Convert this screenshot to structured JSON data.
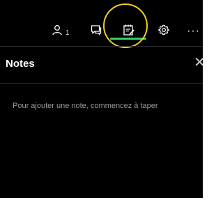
{
  "toolbar": {
    "participants_count": "1",
    "more_label": "···",
    "active_tab": "notes",
    "accent_color": "#2fd06b",
    "highlight_color": "#f0d21a",
    "icons": [
      "person-icon",
      "chat-icon",
      "notes-icon",
      "gear-icon",
      "more-icon"
    ]
  },
  "notes_panel": {
    "title": "Notes",
    "close_label": "✕",
    "placeholder": "Pour ajouter une note, commencez à taper"
  }
}
